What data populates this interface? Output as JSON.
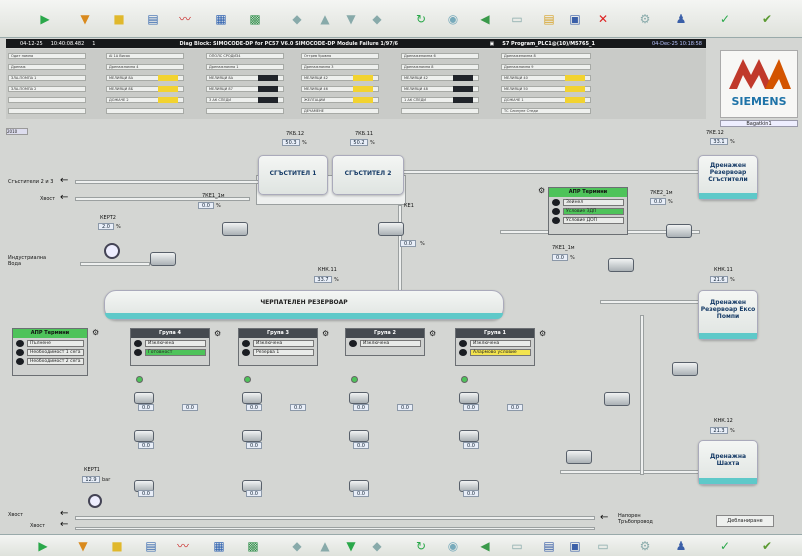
{
  "header": {
    "alarm_date": "04-12-25",
    "alarm_time": "10:40:08.482",
    "alarm_id": "1",
    "alarm_text": "Diag Block: SIMOCODE-DP for PC57 V6.0 SIMOCODE-DP Module Failure 1/97/6",
    "program": "S7 Program_PLC1@(10)/M5765_1",
    "datetime": "04-Dec-25 10:18:58",
    "user": "Bagatkin1"
  },
  "message_rows": [
    [
      "Одит помпа",
      "AI 1A Висок",
      "ОПОЛС СРОДИЗ4",
      "Отгрев Уровня",
      "Дренажепомпа 6",
      "Дренажепомпа 8"
    ],
    [
      "Дренаж",
      "Дренажпомпа 4",
      "Дренажпомпа 1",
      "Дренажпомпа 3",
      "Дренажпомпа 8",
      "Дренажпомпа 9"
    ],
    [
      "ЗЛА-ПОМПА 1",
      "МЕЛИЯЦИ 8А",
      "МЕЛИЯЦИ 8А",
      "МЕЛИЯЦИ 42",
      "МЕЛИЯЦИ 42",
      "МЕЛИЯЦИ 40"
    ],
    [
      "ЗЛА-ПОМПА 2",
      "МЕЛИЯЦИ 8Б",
      "МЕЛИЯЦИ 87",
      "МЕЛИЯЦИ 46",
      "МЕЛИЯЦИ 48",
      "МЕЛИЯЦИ 50"
    ],
    [
      "",
      "ДОЖАЧЕ 2",
      "3 АК СПЕДИ",
      "ЖЕЛГАЦИИ",
      "1 АК СПЕДИ",
      "ДОЖАЧЕ 1"
    ],
    [
      "",
      "",
      "",
      "ДЕЧАМЕНЕ",
      "",
      "ТС Слинуне Стеди"
    ]
  ],
  "logo": {
    "company": "SIEMENS"
  },
  "tanks": {
    "thickener1": "СГЪСТИТЕЛ 1",
    "thickener2": "СГЪСТИТЕЛ 2",
    "main": "ЧЕРПАТЕЛЕН РЕЗЕРВОАР",
    "drain1": "Дренажен Резервоар Сгъстители",
    "drain2": "Дренажен Резервоар Ексо Помпи",
    "drain3": "Дренажна Шахта"
  },
  "labels": {
    "to_thickener": "Сгъстители 2 и 3",
    "tail1": "Хвост",
    "industrial_water": "Индустриална Вода",
    "tail2": "Хвост",
    "tail_out": "Хвост",
    "pressure_pipeline": "Напорен Тръбопровод",
    "to_tailings": "Хвост",
    "status_link": "Дебланиране"
  },
  "values": {
    "level_12": {
      "tag": "7КБ.12",
      "value": "50.3",
      "unit": "%"
    },
    "level_11": {
      "tag": "7КБ.11",
      "value": "50.2",
      "unit": "%"
    },
    "flow_1": {
      "tag": "7КЕ1_1м",
      "value": "0.0",
      "unit": "%"
    },
    "flow_2": {
      "tag": "7КЕ1_1м",
      "value": "0.0",
      "unit": "%"
    },
    "kv": {
      "tag": "КЕ1",
      "value": "0.0",
      "unit": "%"
    },
    "level_main": {
      "tag": "КНК.11",
      "value": "33.7",
      "unit": "%"
    },
    "flow_3": {
      "tag": "7КЕ1_1м",
      "value": "0.0",
      "unit": "%"
    },
    "drain_level_1": {
      "tag": "7КЕ2_1м",
      "value": "0.0",
      "unit": "%"
    },
    "drain_level_2": {
      "tag": "КНК.11",
      "value": "21.6",
      "unit": "%"
    },
    "drain_level_3": {
      "tag": "КНК.12",
      "value": "21.3",
      "unit": "%"
    },
    "tank_right": {
      "tag": "7КЕ.12",
      "value": "33.1",
      "unit": "%"
    },
    "pressure_1": {
      "tag": "КЕРТ1",
      "value": "12.9",
      "unit": "bar"
    },
    "flow_water": {
      "tag": "КЕРТ2",
      "value": "2.0",
      "unit": "%"
    }
  },
  "groups": [
    {
      "title": "Група 4",
      "states": [
        "Изключена",
        "Готовност"
      ],
      "kv1": "0.0",
      "kv2": "0.0",
      "flow": "0.0",
      "press": "0.0"
    },
    {
      "title": "Група 3",
      "states": [
        "Изключена",
        "Резерва 1"
      ],
      "kv1": "0.0",
      "kv2": "0.0",
      "flow": "0.0",
      "press": "0.0"
    },
    {
      "title": "Група 2",
      "states": [
        "Изключена"
      ],
      "kv1": "0.0",
      "kv2": "0.0",
      "flow": "0.0",
      "press": "0.0"
    },
    {
      "title": "Група 1",
      "states": [
        "Изключена",
        "Алармово условие"
      ],
      "kv1": "0.0",
      "kv2": "0.0",
      "flow": "0.0",
      "press": "0.0"
    }
  ],
  "auto_panels": {
    "left": {
      "title": "АПР Термини",
      "items": [
        "Пълнене",
        "Необходимост 1 сега",
        "Необходимост 2 сега"
      ]
    },
    "right": {
      "title": "АПР Термини",
      "items": [
        "Зейнел",
        "Условие ЗДП",
        "Условие ДОП"
      ]
    }
  }
}
